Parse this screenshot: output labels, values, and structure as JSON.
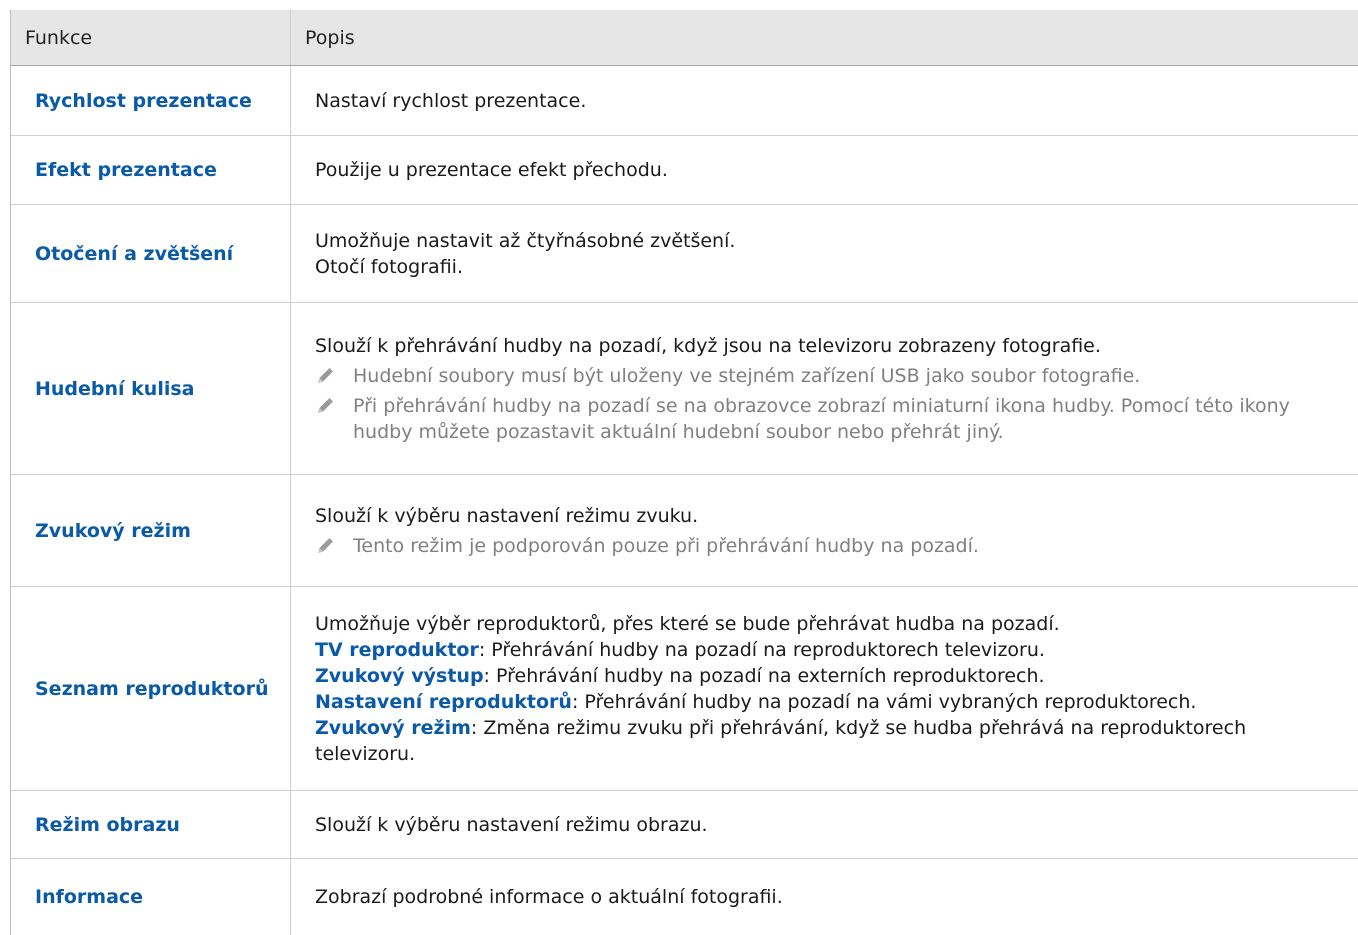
{
  "header": {
    "col1": "Funkce",
    "col2": "Popis"
  },
  "rows": [
    {
      "name": "Rychlost prezentace",
      "lines": [
        "Nastaví rychlost prezentace."
      ]
    },
    {
      "name": "Efekt prezentace",
      "lines": [
        "Použije u prezentace efekt přechodu."
      ]
    },
    {
      "name": "Otočení a zvětšení",
      "lines": [
        "Umožňuje nastavit až čtyřnásobné zvětšení.",
        "Otočí fotografii."
      ]
    },
    {
      "name": "Hudební kulisa",
      "lines": [
        "Slouží k přehrávání hudby na pozadí, když jsou na televizoru zobrazeny fotografie."
      ],
      "notes": [
        "Hudební soubory musí být uloženy ve stejném zařízení USB jako soubor fotografie.",
        "Při přehrávání hudby na pozadí se na obrazovce zobrazí miniaturní ikona hudby. Pomocí této ikony hudby můžete pozastavit aktuální hudební soubor nebo přehrát jiný."
      ]
    },
    {
      "name": "Zvukový režim",
      "lines": [
        "Slouží k výběru nastavení režimu zvuku."
      ],
      "notes": [
        "Tento režim je podporován pouze při přehrávání hudby na pozadí."
      ]
    },
    {
      "name": "Seznam reproduktorů",
      "lines": [
        "Umožňuje výběr reproduktorů, přes které se bude přehrávat hudba na pozadí."
      ],
      "options": [
        {
          "term": "TV reproduktor",
          "text": ": Přehrávání hudby na pozadí na reproduktorech televizoru."
        },
        {
          "term": "Zvukový výstup",
          "text": ": Přehrávání hudby na pozadí na externích reproduktorech."
        },
        {
          "term": "Nastavení reproduktorů",
          "text": ": Přehrávání hudby na pozadí na vámi vybraných reproduktorech."
        },
        {
          "term": "Zvukový režim",
          "text": ": Změna režimu zvuku při přehrávání, když se hudba přehrává na reproduktorech televizoru."
        }
      ]
    },
    {
      "name": "Režim obrazu",
      "lines": [
        "Slouží k výběru nastavení režimu obrazu."
      ]
    },
    {
      "name": "Informace",
      "lines": [
        "Zobrazí podrobné informace o aktuální fotografii."
      ]
    }
  ],
  "icons": {
    "note": "pencil-note-icon"
  },
  "colors": {
    "term": "#0a5aa8",
    "note": "#808080",
    "header_bg": "#e6e6e6"
  }
}
